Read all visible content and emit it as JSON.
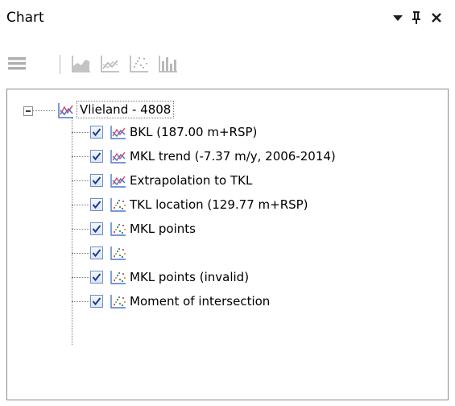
{
  "window": {
    "title": "Chart"
  },
  "title_controls": {
    "dropdown": "chevron-down-icon",
    "pin": "pin-icon",
    "close": "close-icon"
  },
  "toolbar": {
    "items": [
      "menu-lines-icon",
      "area-chart-icon",
      "line-chart-icon",
      "scatter-chart-icon",
      "bar-chart-icon"
    ],
    "state": "disabled"
  },
  "tree": {
    "root": {
      "label": "Vlieland - 4808",
      "icon": "line-chart-icon",
      "expanded": true
    },
    "items": [
      {
        "label": "BKL (187.00 m+RSP)",
        "checked": true,
        "icon": "line-chart-icon"
      },
      {
        "label": "MKL trend (-7.37 m/y, 2006-2014)",
        "checked": true,
        "icon": "line-chart-icon"
      },
      {
        "label": "Extrapolation to TKL",
        "checked": true,
        "icon": "line-chart-icon"
      },
      {
        "label": "TKL location (129.77 m+RSP)",
        "checked": true,
        "icon": "scatter-chart-icon"
      },
      {
        "label": "MKL points",
        "checked": true,
        "icon": "scatter-chart-icon"
      },
      {
        "label": "",
        "checked": true,
        "icon": "scatter-chart-icon"
      },
      {
        "label": "MKL points (invalid)",
        "checked": true,
        "icon": "scatter-chart-icon"
      },
      {
        "label": "Moment of intersection",
        "checked": true,
        "icon": "scatter-chart-icon"
      }
    ]
  },
  "colors": {
    "check": "#1a3d8a",
    "line_icon_red": "#e0506e",
    "line_icon_blue": "#4a78c8",
    "toolbar_disabled": "#b0b0b0"
  }
}
